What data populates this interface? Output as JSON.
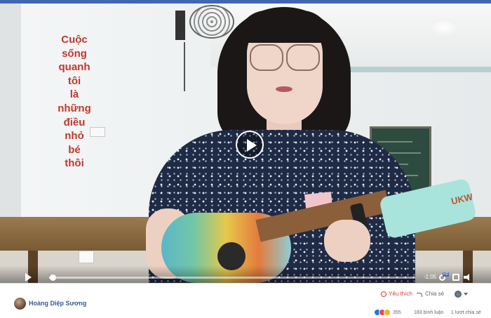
{
  "video": {
    "lyrics": [
      "Cuộc",
      "sống",
      "quanh",
      "tôi",
      "là",
      "những",
      "điều",
      "nhỏ",
      "bé",
      "thôi"
    ],
    "ukulele_logo": "UKW",
    "controls": {
      "time_remaining": "-1:05",
      "hd_badge": "HD",
      "progress": 0.01
    }
  },
  "post": {
    "author": "Hoàng Diệp Sương",
    "like_label": "Yêu thích",
    "share_label": "Chia sẻ",
    "reaction_count": "355",
    "comments": "183 bình luận",
    "shares": "1 lượt chia sẻ"
  },
  "colors": {
    "accent": "#4267b2",
    "author_link": "#385898",
    "like": "#e53935",
    "lyric_text": "#c0392b"
  },
  "icons": [
    "play-icon",
    "hd-settings-icon",
    "fullscreen-icon",
    "volume-icon",
    "heart-icon",
    "share-arrow-icon",
    "page-avatar-icon",
    "caret-down-icon",
    "like-reaction-icon",
    "love-reaction-icon",
    "haha-reaction-icon"
  ]
}
